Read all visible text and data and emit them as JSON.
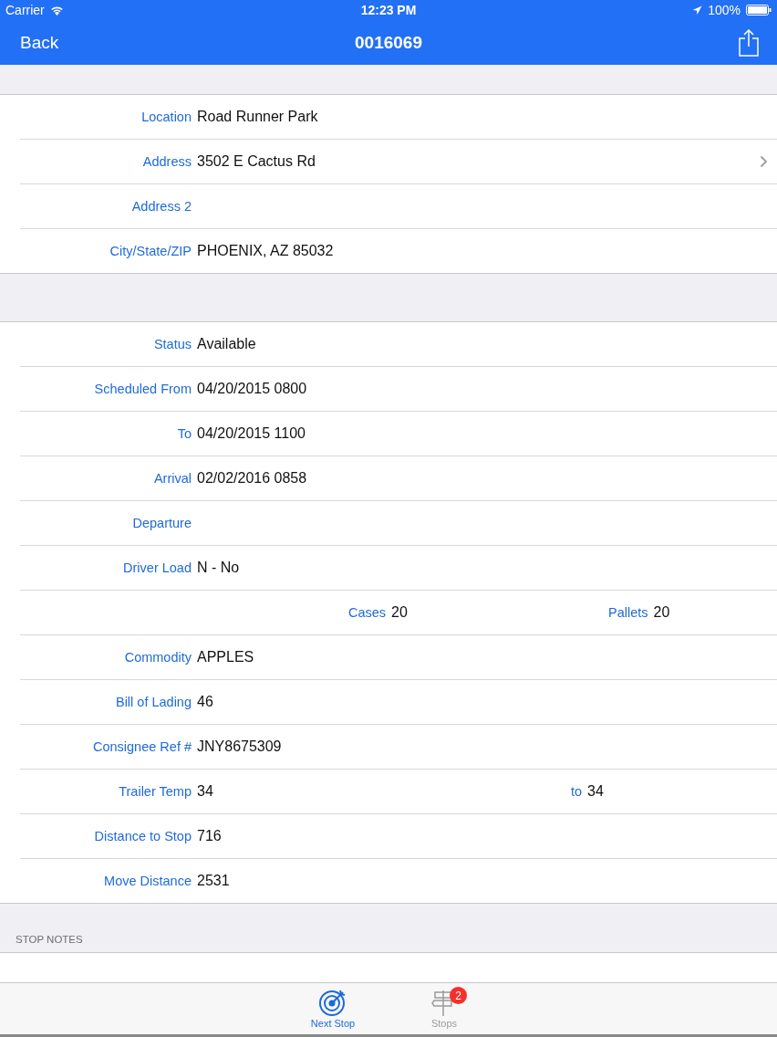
{
  "status_bar": {
    "carrier": "Carrier",
    "time": "12:23 PM",
    "battery": "100%"
  },
  "nav": {
    "back": "Back",
    "title": "0016069"
  },
  "sections": [
    {
      "rows": [
        {
          "kind": "single",
          "fields": [
            {
              "label": "Location",
              "value": "Road Runner Park"
            }
          ]
        },
        {
          "kind": "single",
          "disclosure": true,
          "fields": [
            {
              "label": "Address",
              "value": "3502 E Cactus Rd"
            }
          ]
        },
        {
          "kind": "single",
          "fields": [
            {
              "label": "Address 2"
            }
          ]
        },
        {
          "kind": "single",
          "fields": [
            {
              "label": "City/State/ZIP",
              "value": "PHOENIX, AZ 85032"
            }
          ]
        }
      ]
    },
    {
      "rows": [
        {
          "kind": "single",
          "fields": [
            {
              "label": "Status",
              "value": "Available"
            }
          ]
        },
        {
          "kind": "single",
          "fields": [
            {
              "label": "Scheduled From",
              "value": "04/20/2015 0800"
            }
          ]
        },
        {
          "kind": "single",
          "fields": [
            {
              "label": "To",
              "value": "04/20/2015 1100"
            }
          ]
        },
        {
          "kind": "single",
          "fields": [
            {
              "label": "Arrival",
              "value": "02/02/2016 0858"
            }
          ]
        },
        {
          "kind": "single",
          "fields": [
            {
              "label": "Departure"
            }
          ]
        },
        {
          "kind": "single",
          "fields": [
            {
              "label": "Driver Load",
              "value": "N - No"
            }
          ]
        },
        {
          "kind": "centered-pair",
          "fields": [
            {
              "label": "Cases",
              "value": "20"
            },
            {
              "label": "Pallets",
              "value": "20"
            }
          ]
        },
        {
          "kind": "single",
          "fields": [
            {
              "label": "Commodity",
              "value": "APPLES"
            }
          ]
        },
        {
          "kind": "single",
          "fields": [
            {
              "label": "Bill of Lading",
              "value": "46"
            }
          ]
        },
        {
          "kind": "single",
          "fields": [
            {
              "label": "Consignee Ref #",
              "value": "JNY8675309"
            }
          ]
        },
        {
          "kind": "pair",
          "fields": [
            {
              "label": "Trailer Temp",
              "value": "34"
            },
            {
              "label": "to",
              "value": "34"
            }
          ]
        },
        {
          "kind": "single",
          "fields": [
            {
              "label": "Distance to Stop",
              "value": "716"
            }
          ]
        },
        {
          "kind": "single",
          "fields": [
            {
              "label": "Move Distance",
              "value": "2531"
            }
          ]
        }
      ]
    }
  ],
  "notes_header": "STOP NOTES",
  "tabs": [
    {
      "kind": "target",
      "label": "Next Stop",
      "selected": true
    },
    {
      "kind": "signpost",
      "label": "Stops",
      "selected": false,
      "badge": "2"
    }
  ]
}
